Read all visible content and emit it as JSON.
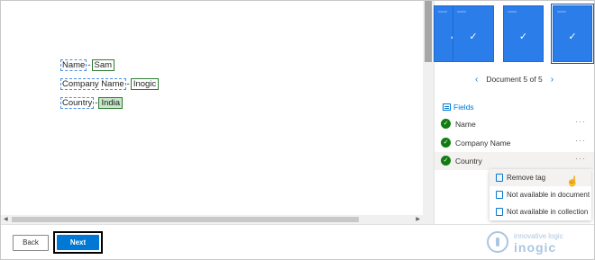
{
  "document": {
    "lines": [
      {
        "label": "Name",
        "sep": "-",
        "value": "Sam",
        "filled": false
      },
      {
        "label": "Company Name",
        "sep": "-",
        "value": "Inogic",
        "filled": false
      },
      {
        "label": "Country",
        "sep": "-",
        "value": "India",
        "filled": true
      }
    ]
  },
  "pane": {
    "doc_nav_text": "Document 5 of 5",
    "fields_heading": "Fields",
    "fields": [
      {
        "name": "Name",
        "status": "tagged"
      },
      {
        "name": "Company Name",
        "status": "tagged"
      },
      {
        "name": "Country",
        "status": "tagged"
      }
    ]
  },
  "context_menu": {
    "items": [
      "Remove tag",
      "Not available in document",
      "Not available in collection"
    ]
  },
  "footer": {
    "back_label": "Back",
    "next_label": "Next"
  },
  "watermark": {
    "line1": "innovative logic",
    "line2": "inogic"
  },
  "colors": {
    "accent": "#0078d4",
    "thumbnail": "#2b7de9",
    "success": "#107c10",
    "value_highlight": "#c8e6c9"
  }
}
